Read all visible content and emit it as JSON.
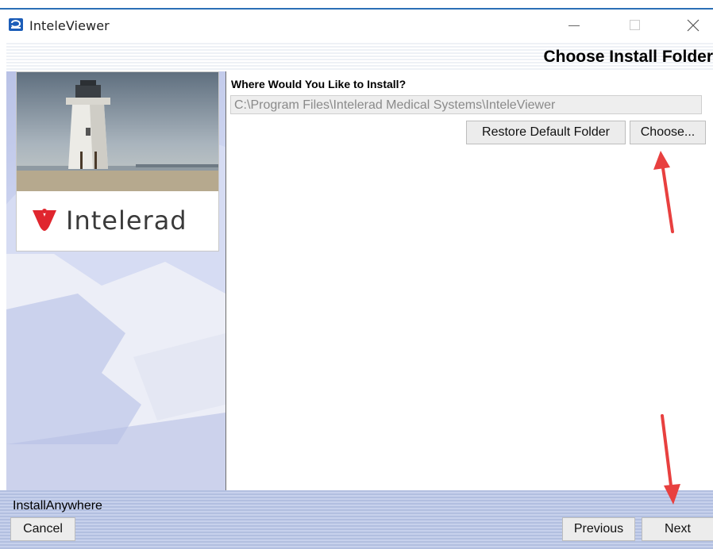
{
  "window": {
    "title": "InteleViewer",
    "controls": {
      "minimize_icon": "minimize-icon",
      "maximize_icon": "maximize-icon",
      "close_icon": "close-icon"
    }
  },
  "header": {
    "title": "Choose Install Folder"
  },
  "brand": {
    "logo_text": "Intelerad",
    "logo_icon": "intelerad-logo-icon",
    "image": "lighthouse-photo"
  },
  "content": {
    "prompt": "Where Would You Like to Install?",
    "install_path": "C:\\Program Files\\Intelerad Medical Systems\\InteleViewer",
    "restore_default_label": "Restore Default Folder",
    "choose_label": "Choose..."
  },
  "footer": {
    "label": "InstallAnywhere",
    "cancel_label": "Cancel",
    "previous_label": "Previous",
    "next_label": "Next"
  },
  "colors": {
    "accent": "#2b6fb6",
    "annotation_arrow": "#e8403f",
    "logo_red": "#e0262e"
  }
}
